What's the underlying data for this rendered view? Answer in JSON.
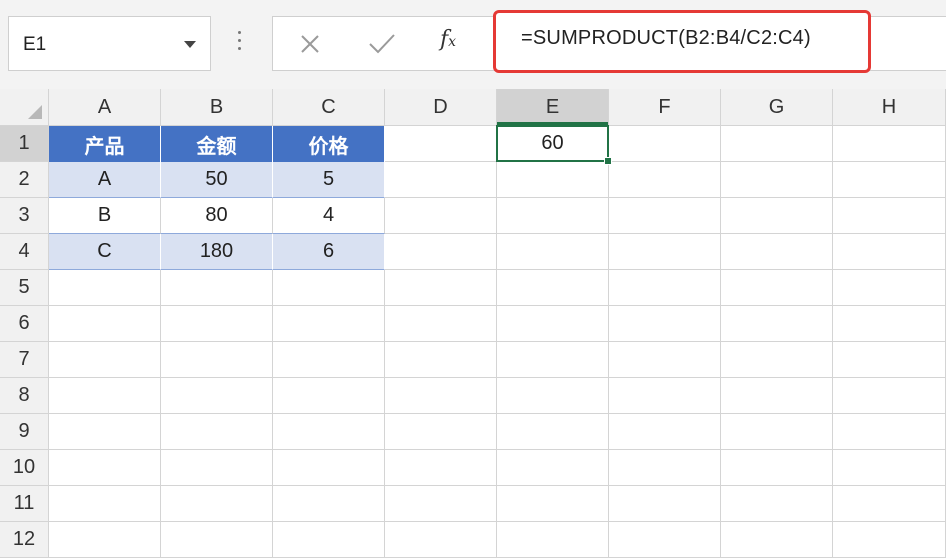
{
  "name_box": {
    "value": "E1"
  },
  "formula_bar": {
    "cancel_icon": "close-icon",
    "enter_icon": "check-icon",
    "function_icon": "fx-icon",
    "fx_main": "f",
    "fx_sub": "x",
    "formula": "=SUMPRODUCT(B2:B4/C2:C4)"
  },
  "colors": {
    "header_fill": "#4472c4",
    "band_fill": "#d9e1f2",
    "selection": "#217346",
    "highlight_box": "#e53935"
  },
  "sheet": {
    "columns": [
      "A",
      "B",
      "C",
      "D",
      "E",
      "F",
      "G",
      "H"
    ],
    "rows": [
      "1",
      "2",
      "3",
      "4",
      "5",
      "6",
      "7",
      "8",
      "9",
      "10",
      "11",
      "12"
    ],
    "selected_column": "E",
    "selected_row": "1",
    "cells": {
      "A1": "产品",
      "B1": "金额",
      "C1": "价格",
      "A2": "A",
      "B2": "50",
      "C2": "5",
      "A3": "B",
      "B3": "80",
      "C3": "4",
      "A4": "C",
      "B4": "180",
      "C4": "6",
      "E1": "60"
    }
  }
}
